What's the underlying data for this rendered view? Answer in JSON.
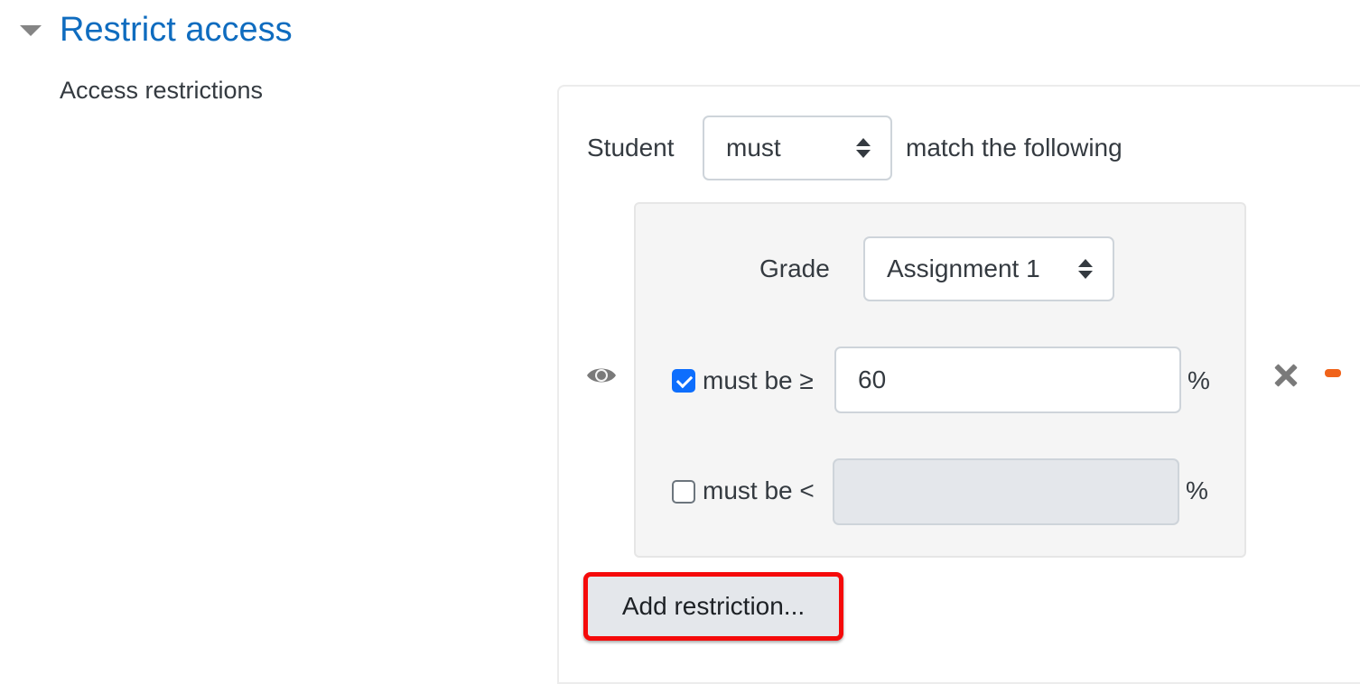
{
  "section": {
    "title": "Restrict access",
    "toggle_icon": "caret-down-icon",
    "field_label": "Access restrictions"
  },
  "restriction_set": {
    "prefix": "Student",
    "match_select": {
      "value": "must",
      "icon": "sort-updown-icon"
    },
    "suffix": "match the following"
  },
  "condition": {
    "visibility_icon": "eye-icon",
    "grade_label": "Grade",
    "grade_select": {
      "value": "Assignment 1",
      "icon": "sort-updown-icon"
    },
    "min": {
      "checked": true,
      "label": "must be ≥",
      "value": "60",
      "unit": "%"
    },
    "max": {
      "checked": false,
      "label": "must be <",
      "value": "",
      "unit": "%"
    },
    "delete_icon": "close-icon",
    "extra_icon": "minus-icon"
  },
  "actions": {
    "add_restriction_label": "Add restriction..."
  },
  "colors": {
    "link": "#0f6cbf",
    "checkbox_checked": "#0d6efd",
    "highlight_border": "#f50a0a",
    "minus_icon": "#f0631a"
  }
}
